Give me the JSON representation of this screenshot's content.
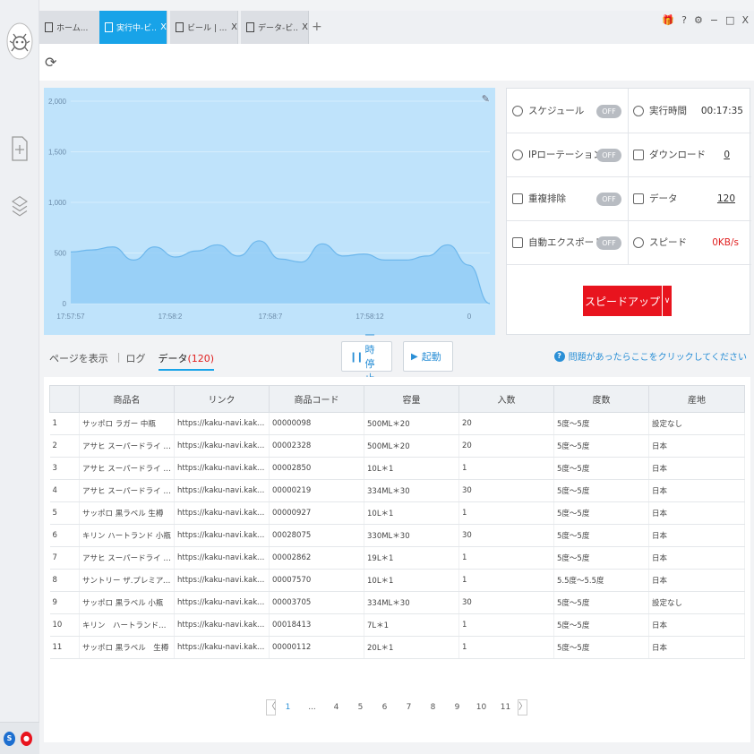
{
  "tabs": [
    {
      "label": "ホーム...",
      "close": "",
      "active": false
    },
    {
      "label": "実行中-ビ...",
      "close": "X",
      "active": true
    },
    {
      "label": "ビール | ...",
      "close": "X",
      "active": false
    },
    {
      "label": "データ-ビ...",
      "close": "X",
      "active": false
    }
  ],
  "tab_add": "+",
  "window_controls": {
    "gift": "🎁",
    "help": "?",
    "settings": "⚙",
    "minimize": "−",
    "maximize": "□",
    "close": "X"
  },
  "refresh_icon": "⟳",
  "chart_data": {
    "type": "area",
    "x_ticks": [
      "17:57:57",
      "17:58:2",
      "17:58:7",
      "17:58:12",
      "0"
    ],
    "y_ticks": [
      "2,000",
      "1,500",
      "1,000",
      "500",
      "0"
    ],
    "ylim": [
      0,
      2000
    ],
    "grid": true,
    "color": "#8ccaf5",
    "values": [
      510,
      530,
      560,
      430,
      560,
      460,
      520,
      580,
      470,
      620,
      440,
      410,
      590,
      470,
      490,
      430,
      430,
      470,
      580,
      380,
      0
    ]
  },
  "stats": {
    "schedule": {
      "label": "スケジュール",
      "toggle": "OFF"
    },
    "ip_rotation": {
      "label": "IPローテーション",
      "toggle": "OFF"
    },
    "dedup": {
      "label": "重複排除",
      "toggle": "OFF"
    },
    "auto_export": {
      "label": "自動エクスポート",
      "toggle": "OFF"
    },
    "run_time": {
      "label": "実行時間",
      "value": "00:17:35"
    },
    "download": {
      "label": "ダウンロード",
      "value": "0"
    },
    "data": {
      "label": "データ",
      "value": "120"
    },
    "speed": {
      "label": "スピード",
      "value": "0KB/s"
    },
    "speedup_label": "スピードアップ",
    "speedup_dropdown": "∨"
  },
  "subtabs": {
    "page": "ページを表示",
    "log": "ログ",
    "data": "データ",
    "data_count": "(120)"
  },
  "buttons": {
    "pause": "一時停止",
    "start": "起動"
  },
  "help_text": "問題があったらここをクリックしてください",
  "help_icon": "?",
  "table": {
    "headers": [
      "",
      "商品名",
      "リンク",
      "商品コード",
      "容量",
      "入数",
      "度数",
      "産地"
    ],
    "rows": [
      [
        "1",
        "サッポロ ラガー 中瓶",
        "https://kaku-navi.kakuyasu.co.jp...",
        "00000098",
        "500ML＊20",
        "20",
        "5度～5度",
        "設定なし"
      ],
      [
        "2",
        "アサヒ スーパードライ 中瓶",
        "https://kaku-navi.kakuyasu.co.jp...",
        "00002328",
        "500ML＊20",
        "20",
        "5度～5度",
        "日本"
      ],
      [
        "3",
        "アサヒ スーパードライ 生樽",
        "https://kaku-navi.kakuyasu.co.jp...",
        "00002850",
        "10L＊1",
        "1",
        "5度～5度",
        "日本"
      ],
      [
        "4",
        "アサヒ スーパードライ 小瓶",
        "https://kaku-navi.kakuyasu.co.jp...",
        "00000219",
        "334ML＊30",
        "30",
        "5度～5度",
        "日本"
      ],
      [
        "5",
        "サッポロ 黒ラベル 生樽",
        "https://kaku-navi.kakuyasu.co.jp...",
        "00000927",
        "10L＊1",
        "1",
        "5度～5度",
        "日本"
      ],
      [
        "6",
        "キリン ハートランド 小瓶",
        "https://kaku-navi.kakuyasu.co.jp...",
        "00028075",
        "330ML＊30",
        "30",
        "5度～5度",
        "日本"
      ],
      [
        "7",
        "アサヒ スーパードライ 生樽",
        "https://kaku-navi.kakuyasu.co.jp...",
        "00002862",
        "19L＊1",
        "1",
        "5度～5度",
        "日本"
      ],
      [
        "8",
        "サントリー ザ.プレミアムモル...",
        "https://kaku-navi.kakuyasu.co.jp...",
        "00007570",
        "10L＊1",
        "1",
        "5.5度～5.5度",
        "日本"
      ],
      [
        "9",
        "サッポロ 黒ラベル 小瓶",
        "https://kaku-navi.kakuyasu.co.jp...",
        "00003705",
        "334ML＊30",
        "30",
        "5度～5度",
        "設定なし"
      ],
      [
        "10",
        "キリン　ハートランド　生樽",
        "https://kaku-navi.kakuyasu.co.jp...",
        "00018413",
        "7L＊1",
        "1",
        "5度～5度",
        "日本"
      ],
      [
        "11",
        "サッポロ 黒ラベル　生樽",
        "https://kaku-navi.kakuyasu.co.jp...",
        "00000112",
        "20L＊1",
        "1",
        "5度～5度",
        "日本"
      ]
    ]
  },
  "pagination": {
    "prev": "〈",
    "next": "〉",
    "pages": [
      "1",
      "...",
      "4",
      "5",
      "6",
      "7",
      "8",
      "9",
      "10",
      "11"
    ],
    "current": "1"
  },
  "status_icons": {
    "a": "S",
    "b": "●"
  }
}
